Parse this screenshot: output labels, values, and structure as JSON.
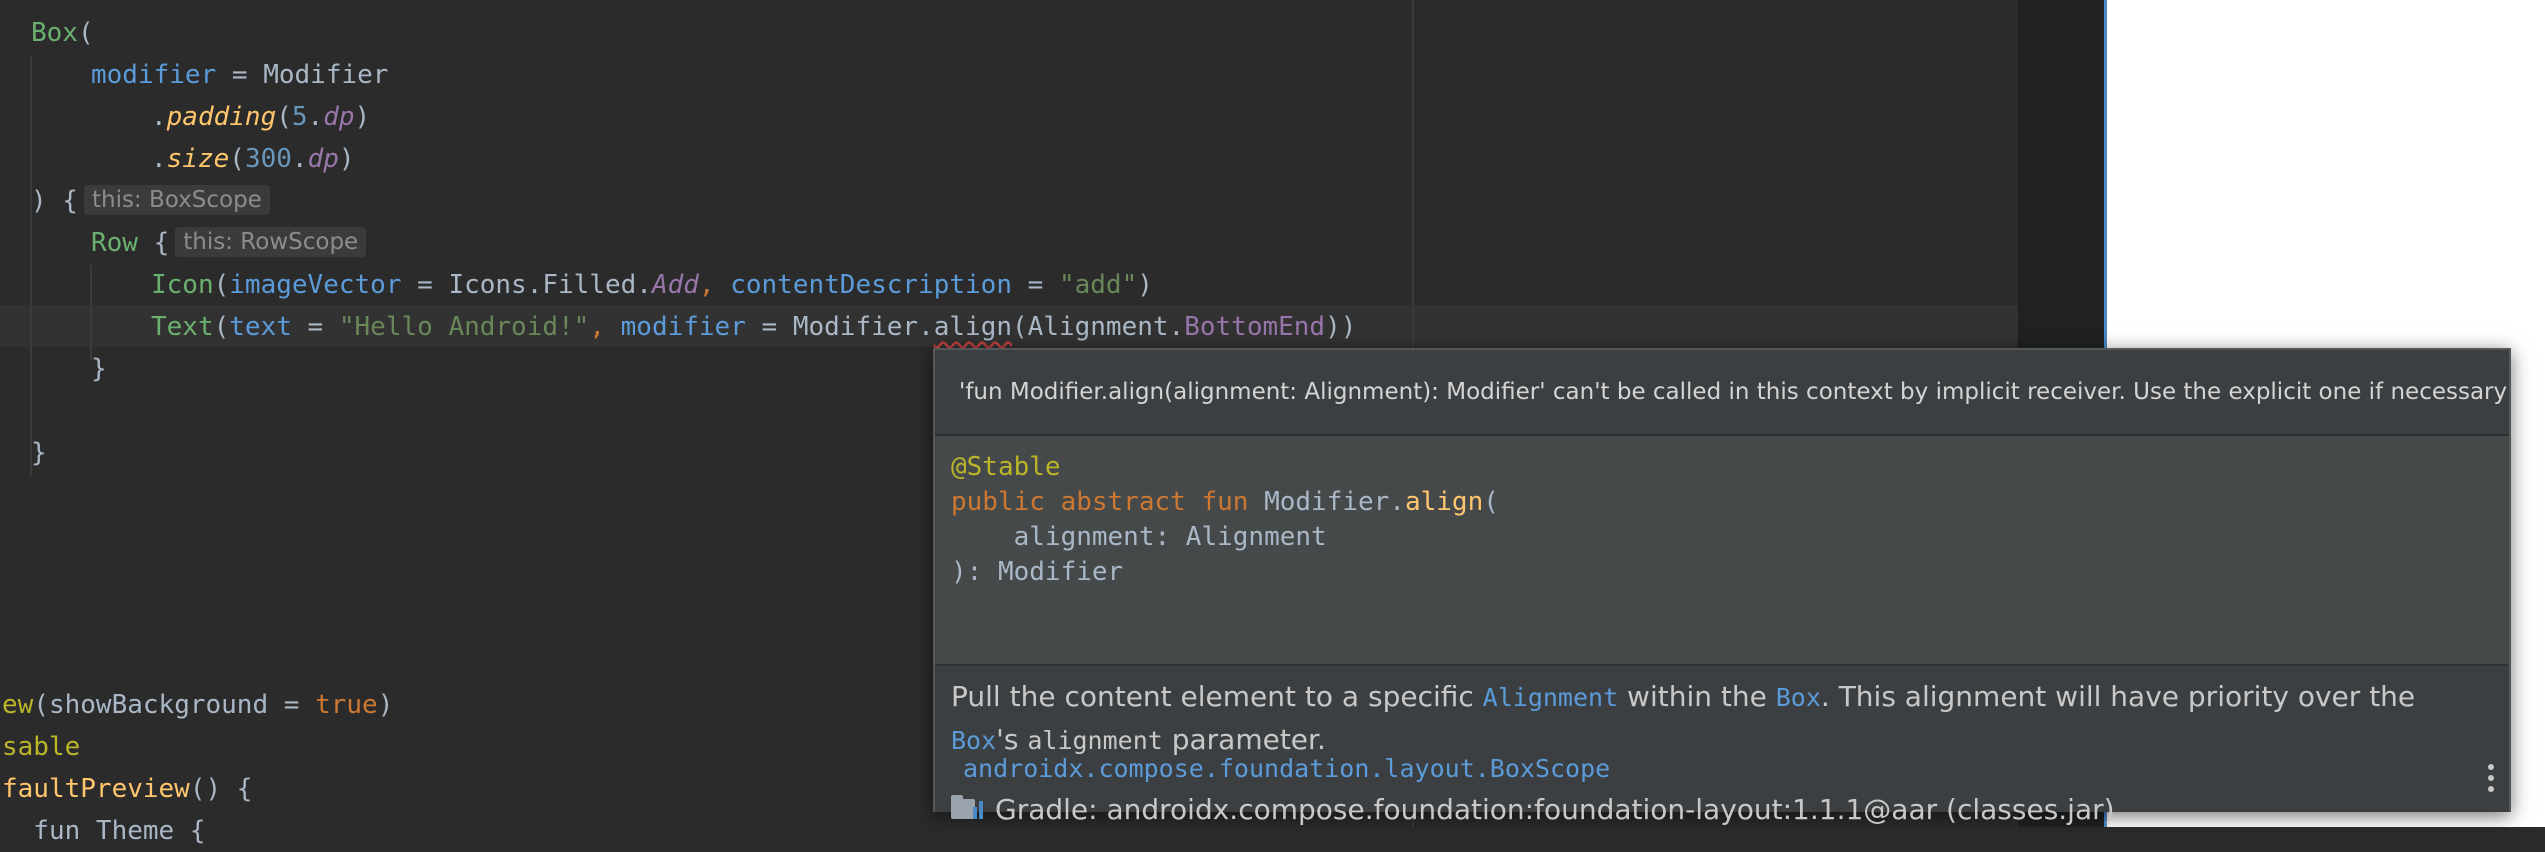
{
  "code_lines": {
    "l1": {
      "fn": "Box",
      "rest": "("
    },
    "l2": {
      "param": "modifier",
      "eq": " = ",
      "val": "Modifier"
    },
    "l3": {
      "dot": ".",
      "fn": "padding",
      "open": "(",
      "num": "5",
      "dot2": ".",
      "unit": "dp",
      "close": ")"
    },
    "l4": {
      "dot": ".",
      "fn": "size",
      "open": "(",
      "num": "300",
      "dot2": ".",
      "unit": "dp",
      "close": ")"
    },
    "l5": {
      "code": ") {",
      "hint": "this: BoxScope"
    },
    "l6": {
      "fn": "Row",
      "code": " {",
      "hint": "this: RowScope"
    },
    "l7": {
      "fn": "Icon",
      "open": "(",
      "param1": "imageVector",
      "eq1": " = ",
      "val1": "Icons.Filled.",
      "prop": "Add",
      "comma": ", ",
      "param2": "contentDescription",
      "eq2": " = ",
      "str": "\"add\"",
      "close": ")"
    },
    "l8": {
      "fn": "Text",
      "open": "(",
      "param1": "text",
      "eq1": " = ",
      "str": "\"Hello Android!\"",
      "comma": ", ",
      "param2": "modifier",
      "eq2": " = ",
      "mod": "Modifier.",
      "align": "align",
      "args": "(Alignment.",
      "prop": "BottomEnd",
      "close": "))"
    },
    "l9": {
      "code": "}"
    },
    "l10": {
      "code": "}"
    },
    "l11": {
      "fn": "ew",
      "open": "(showBackground = ",
      "kw": "true",
      "close": ")"
    },
    "l12": {
      "code": "sable"
    },
    "l13": {
      "fn": "faultPreview",
      "code": "() {"
    },
    "l14": {
      "code": "  fun Theme {"
    }
  },
  "popup": {
    "error": "'fun Modifier.align(alignment: Alignment): Modifier' can't be called in this context by implicit receiver. Use the explicit one if necessary",
    "signature": {
      "annotation": "@Stable",
      "modifiers": "public abstract fun ",
      "receiver": "Modifier.",
      "name": "align",
      "open": "(",
      "param": "    alignment: Alignment",
      "close": "): Modifier"
    },
    "doc": {
      "p1": "Pull the content element to a specific ",
      "code1": "Alignment",
      "p2": " within the ",
      "code2": "Box",
      "p3": ". This alignment will have priority over the ",
      "code3": "Box",
      "p4": "'s ",
      "code4": "alignment",
      "p5": " parameter.",
      "package": "androidx.compose.foundation.layout.BoxScope",
      "gradle": "Gradle: androidx.compose.foundation:foundation-layout:1.1.1@aar (classes.jar)"
    }
  },
  "icons": {
    "gradle": "gradle-library-icon",
    "more": "more-vertical-icon"
  },
  "colors": {
    "editor_bg": "#2b2b2b",
    "popup_bg": "#3c3f41",
    "preview_accent": "#4a88c7",
    "error_squiggle": "#bc3f3c"
  }
}
